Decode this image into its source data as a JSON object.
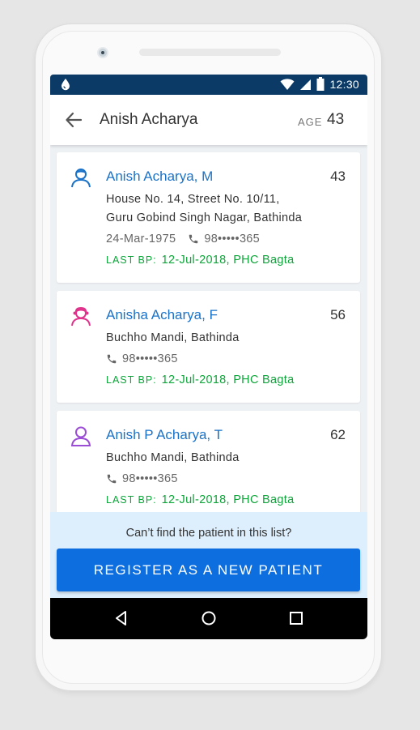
{
  "status_bar": {
    "time": "12:30"
  },
  "app_bar": {
    "title": "Anish Acharya",
    "age_label": "AGE",
    "age_value": "43"
  },
  "patients": [
    {
      "name": "Anish Acharya, M",
      "age": "43",
      "address_line1": "House No. 14, Street No. 10/11,",
      "address_line2": "Guru Gobind Singh Nagar, Bathinda",
      "dob": "24-Mar-1975",
      "phone": "98•••••365",
      "last_bp_label": "LAST BP:",
      "last_bp": "12-Jul-2018, PHC Bagta",
      "avatar_color": "#1a73c9"
    },
    {
      "name": "Anisha Acharya, F",
      "age": "56",
      "address_line1": "Buchho Mandi, Bathinda",
      "phone": "98•••••365",
      "last_bp_label": "LAST BP:",
      "last_bp": "12-Jul-2018, PHC Bagta",
      "avatar_color": "#e0348c"
    },
    {
      "name": "Anish P Acharya, T",
      "age": "62",
      "address_line1": "Buchho Mandi, Bathinda",
      "phone": "98•••••365",
      "last_bp_label": "LAST BP:",
      "last_bp": "12-Jul-2018, PHC Bagta",
      "avatar_color": "#9b4dd6"
    }
  ],
  "footer": {
    "prompt": "Can’t find the patient in this list?",
    "register_label": "REGISTER AS A NEW PATIENT"
  },
  "colors": {
    "status_bar": "#0b3a66",
    "primary_button": "#0d6ee0",
    "link_blue": "#1a73c9",
    "bp_green": "#0ea53a",
    "footer_bg": "#ddeefc"
  },
  "icons": [
    "blood-drop-icon",
    "wifi-icon",
    "signal-icon",
    "battery-icon",
    "back-arrow-icon",
    "patient-avatar-icon",
    "phone-icon",
    "nav-back-icon",
    "nav-home-icon",
    "nav-recents-icon"
  ]
}
